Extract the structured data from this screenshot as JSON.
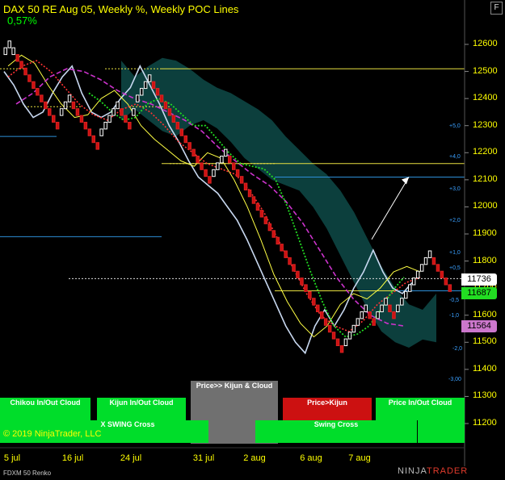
{
  "header": {
    "title": "DAX 50 RE Aug 05, Weekly %, Weekly POC Lines",
    "percent_change": "0,57%",
    "format_button": "F"
  },
  "footer": {
    "copyright": "© 2019 NinjaTrader, LLC",
    "instrument": "FDXM 50 Renko",
    "logo_left": "NINJA",
    "logo_right": "TRADER"
  },
  "signals": {
    "top_row": [
      {
        "label": "Chikou In/Out Cloud",
        "color": "#00dd2a"
      },
      {
        "label": "Kijun In/Out Cloud",
        "color": "#00dd2a"
      },
      {
        "label": "Price>> Kijun & Cloud",
        "color": "#707070"
      },
      {
        "label": "Price>Kijun",
        "color": "#cc1111"
      },
      {
        "label": "Price In/Out Cloud",
        "color": "#00dd2a"
      }
    ],
    "bottom_row": [
      {
        "label": "X SWING Cross",
        "color": "#00dd2a"
      },
      {
        "label": "Swing Cross",
        "color": "#00dd2a"
      }
    ]
  },
  "price_tags": [
    {
      "value": "11736",
      "color": "#ffffff",
      "text_color": "#000000"
    },
    {
      "value": "11687",
      "color": "#22dd22",
      "text_color": "#000000"
    },
    {
      "value": "11564",
      "color": "#cc77cc",
      "text_color": "#000000"
    }
  ],
  "std_labels": [
    "+5,0",
    "+4,0",
    "+3,0",
    "+2,0",
    "+1,0",
    "+0,5",
    "-0,5",
    "-1,0",
    "-2,0",
    "-3,00"
  ],
  "chart_data": {
    "type": "line",
    "title": "DAX 50 RE Aug 05, Weekly %, Weekly POC Lines",
    "x_ticks": [
      "5 jul",
      "16 jul",
      "24 jul",
      "31 jul",
      "2 aug",
      "6 aug",
      "7 aug"
    ],
    "y_ticks": [
      12600,
      12500,
      12400,
      12300,
      12200,
      12100,
      12000,
      11900,
      11800,
      11700,
      11600,
      11500,
      11400,
      11300,
      11200
    ],
    "ylim": [
      11140,
      12700
    ],
    "renko_brick_size": 25,
    "renko_bricks": [
      [
        12575,
        "up"
      ],
      [
        12600,
        "up"
      ],
      [
        12575,
        "up"
      ],
      [
        12550,
        "down"
      ],
      [
        12525,
        "down"
      ],
      [
        12500,
        "down"
      ],
      [
        12475,
        "down"
      ],
      [
        12450,
        "down"
      ],
      [
        12425,
        "down"
      ],
      [
        12400,
        "down"
      ],
      [
        12375,
        "down"
      ],
      [
        12350,
        "down"
      ],
      [
        12325,
        "down"
      ],
      [
        12300,
        "down"
      ],
      [
        12350,
        "up"
      ],
      [
        12375,
        "up"
      ],
      [
        12400,
        "up"
      ],
      [
        12375,
        "down"
      ],
      [
        12350,
        "down"
      ],
      [
        12325,
        "down"
      ],
      [
        12300,
        "down"
      ],
      [
        12275,
        "down"
      ],
      [
        12250,
        "down"
      ],
      [
        12225,
        "down"
      ],
      [
        12275,
        "up"
      ],
      [
        12300,
        "up"
      ],
      [
        12325,
        "up"
      ],
      [
        12350,
        "up"
      ],
      [
        12375,
        "up"
      ],
      [
        12350,
        "down"
      ],
      [
        12325,
        "down"
      ],
      [
        12300,
        "down"
      ],
      [
        12350,
        "up"
      ],
      [
        12400,
        "up"
      ],
      [
        12425,
        "up"
      ],
      [
        12450,
        "up"
      ],
      [
        12475,
        "up"
      ],
      [
        12450,
        "down"
      ],
      [
        12425,
        "down"
      ],
      [
        12400,
        "down"
      ],
      [
        12375,
        "down"
      ],
      [
        12350,
        "down"
      ],
      [
        12325,
        "down"
      ],
      [
        12300,
        "down"
      ],
      [
        12275,
        "down"
      ],
      [
        12250,
        "down"
      ],
      [
        12225,
        "down"
      ],
      [
        12200,
        "down"
      ],
      [
        12175,
        "down"
      ],
      [
        12150,
        "down"
      ],
      [
        12125,
        "down"
      ],
      [
        12100,
        "down"
      ],
      [
        12125,
        "up"
      ],
      [
        12150,
        "up"
      ],
      [
        12175,
        "up"
      ],
      [
        12200,
        "up"
      ],
      [
        12175,
        "down"
      ],
      [
        12150,
        "down"
      ],
      [
        12125,
        "down"
      ],
      [
        12100,
        "down"
      ],
      [
        12075,
        "down"
      ],
      [
        12050,
        "down"
      ],
      [
        12025,
        "down"
      ],
      [
        12000,
        "down"
      ],
      [
        11975,
        "down"
      ],
      [
        11950,
        "down"
      ],
      [
        11925,
        "down"
      ],
      [
        11900,
        "down"
      ],
      [
        11875,
        "down"
      ],
      [
        11850,
        "down"
      ],
      [
        11825,
        "down"
      ],
      [
        11800,
        "down"
      ],
      [
        11775,
        "down"
      ],
      [
        11750,
        "down"
      ],
      [
        11725,
        "down"
      ],
      [
        11700,
        "down"
      ],
      [
        11675,
        "down"
      ],
      [
        11650,
        "down"
      ],
      [
        11625,
        "down"
      ],
      [
        11600,
        "down"
      ],
      [
        11575,
        "down"
      ],
      [
        11550,
        "down"
      ],
      [
        11525,
        "down"
      ],
      [
        11500,
        "down"
      ],
      [
        11475,
        "down"
      ],
      [
        11500,
        "up"
      ],
      [
        11525,
        "up"
      ],
      [
        11550,
        "up"
      ],
      [
        11575,
        "up"
      ],
      [
        11600,
        "up"
      ],
      [
        11625,
        "up"
      ],
      [
        11600,
        "down"
      ],
      [
        11575,
        "down"
      ],
      [
        11600,
        "up"
      ],
      [
        11625,
        "up"
      ],
      [
        11650,
        "up"
      ],
      [
        11625,
        "down"
      ],
      [
        11600,
        "down"
      ],
      [
        11625,
        "up"
      ],
      [
        11650,
        "up"
      ],
      [
        11675,
        "up"
      ],
      [
        11700,
        "up"
      ],
      [
        11725,
        "up"
      ],
      [
        11750,
        "up"
      ],
      [
        11775,
        "up"
      ],
      [
        11800,
        "up"
      ],
      [
        11825,
        "up"
      ],
      [
        11800,
        "down"
      ],
      [
        11775,
        "down"
      ],
      [
        11750,
        "down"
      ],
      [
        11725,
        "down"
      ],
      [
        11700,
        "down"
      ]
    ],
    "series": [
      {
        "name": "chikou",
        "color": "#c8d8f0",
        "values": [
          12500,
          12450,
          12380,
          12330,
          12350,
          12420,
          12480,
          12520,
          12420,
          12350,
          12330,
          12350,
          12400,
          12440,
          12520,
          12450,
          12380,
          12300,
          12240,
          12170,
          12110,
          12080,
          12050,
          12000,
          11950,
          11880,
          11800,
          11720,
          11640,
          11560,
          11500,
          11460,
          11560,
          11620,
          11560,
          11620,
          11700,
          11760,
          11840,
          11760,
          11700,
          11680,
          11720
        ]
      },
      {
        "name": "tenkan",
        "color": "#ffff44",
        "values": [
          12520,
          12560,
          12530,
          12450,
          12380,
          12330,
          12340,
          12400,
          12430,
          12380,
          12300,
          12250,
          12210,
          12170,
          12150,
          12200,
          12180,
          12100,
          12000,
          11880,
          11750,
          11650,
          11570,
          11520,
          11560,
          11640,
          11680,
          11660,
          11700,
          11760,
          11780,
          11760
        ]
      },
      {
        "name": "kijun",
        "color": "#ff3333",
        "values": [
          12480,
          12520,
          12540,
          12500,
          12440,
          12380,
          12340,
          12320,
          12360,
          12380,
          12350,
          12300,
          12240,
          12200,
          12160,
          12140,
          12120,
          12060,
          11980,
          11880,
          11780,
          11680,
          11600,
          11560,
          11540,
          11580,
          11640,
          11680,
          11720,
          11740
        ]
      },
      {
        "name": "senkou",
        "color": "#cc33cc",
        "values": [
          12380,
          12420,
          12480,
          12510,
          12500,
          12470,
          12430,
          12400,
          12380,
          12350,
          12320,
          12280,
          12220,
          12170,
          12120,
          12080,
          12020,
          11940,
          11840,
          11740,
          11660,
          11600,
          11570,
          11560
        ]
      },
      {
        "name": "swing",
        "color": "#22dd22",
        "values": [
          12420,
          12390,
          12350,
          12320,
          12330,
          12380,
          12400,
          12380,
          12340,
          12300,
          12300,
          12250,
          12200,
          12160,
          12150,
          12140,
          12100,
          12000,
          11880,
          11760,
          11650,
          11560,
          11520,
          11530,
          11560,
          11620,
          11690,
          11740
        ]
      }
    ],
    "poc_lines": [
      12510,
      12160,
      11735,
      11690
    ],
    "blue_levels": [
      12260,
      12110,
      11890,
      11690
    ],
    "arrow_from": [
      11880,
      "7 aug"
    ],
    "arrow_to": [
      12110,
      "7 aug"
    ]
  }
}
